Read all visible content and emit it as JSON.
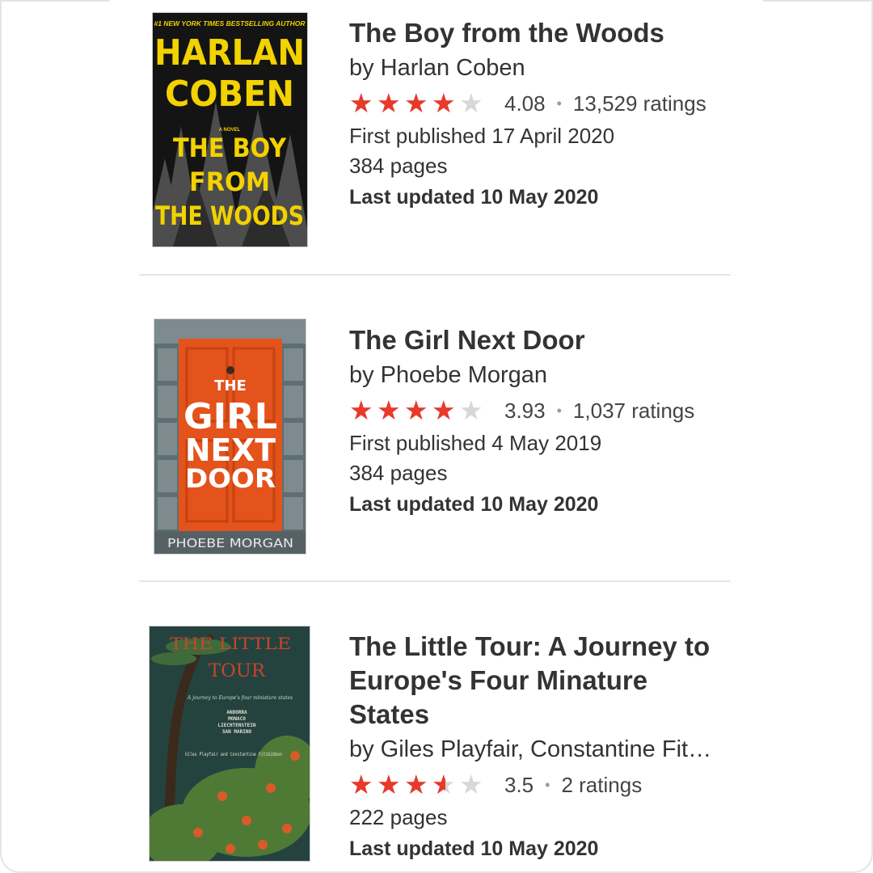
{
  "books": [
    {
      "title": "The Boy from the Woods",
      "author": "by Harlan Coben",
      "rating": 4.08,
      "stars_filled": 4.0,
      "rating_label": "4.08",
      "ratings_count": "13,529 ratings",
      "first_published": "First published 17 April 2020",
      "pages": "384 pages",
      "last_updated": "Last updated 10 May 2020",
      "cover": {
        "tagline": "#1 NEW YORK TIMES BESTSELLING AUTHOR",
        "line1": "HARLAN",
        "line2": "COBEN",
        "kicker": "A NOVEL",
        "line3": "THE BOY",
        "line4": "FROM",
        "line5": "THE WOODS"
      }
    },
    {
      "title": "The Girl Next Door",
      "author": "by Phoebe Morgan",
      "rating": 3.93,
      "stars_filled": 4.0,
      "rating_label": "3.93",
      "ratings_count": "1,037 ratings",
      "first_published": "First published 4 May 2019",
      "pages": "384 pages",
      "last_updated": "Last updated 10 May 2020",
      "cover": {
        "line1": "THE",
        "line2": "GIRL",
        "line3": "NEXT",
        "line4": "DOOR",
        "author": "PHOEBE MORGAN"
      }
    },
    {
      "title": "The Little Tour: A Journey to Europe's Four Minature States",
      "author": "by Giles Playfair, Constantine Fit…",
      "rating": 3.5,
      "stars_filled": 3.5,
      "rating_label": "3.5",
      "ratings_count": "2 ratings",
      "pages": "222 pages",
      "last_updated": "Last updated 10 May 2020",
      "cover": {
        "line1": "THE LITTLE",
        "line2": "TOUR",
        "subtitle": "A journey to Europe's four miniature states",
        "states": [
          "ANDORRA",
          "MONACO",
          "LIECHTENSTEIN",
          "SAN MARINO"
        ],
        "authors": "Giles Playfair and Constantine FitzGibbon"
      }
    }
  ],
  "colors": {
    "star_filled": "#e8392a",
    "star_empty": "#d8d8d8",
    "text": "#333333",
    "divider": "#e6e6e6"
  },
  "icons": [
    "star-icon"
  ]
}
